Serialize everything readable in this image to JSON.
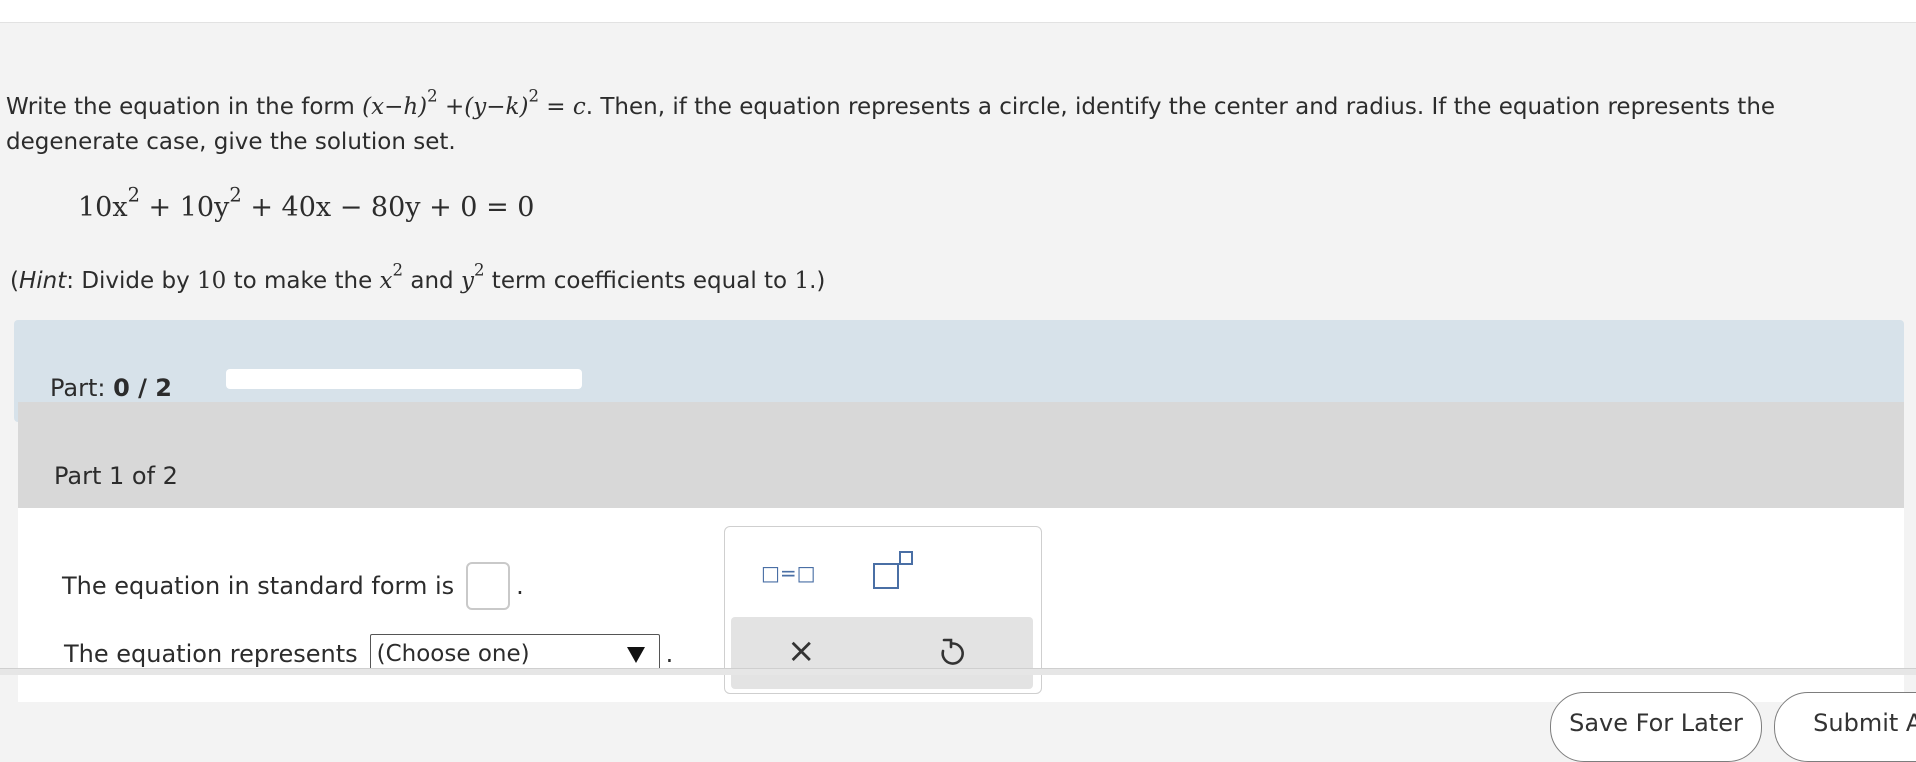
{
  "question": {
    "intro": "Write the equation in the form ",
    "form_math": "(x−h)",
    "form_plus": " +",
    "form_math2": "(y−k)",
    "form_eq": " = c",
    "rest": ". Then, if the equation represents a circle, identify the center and radius. If the equation represents the degenerate case, give the solution set."
  },
  "equation": {
    "t1": "10x",
    "t2": " + 10y",
    "t3": " + 40x − 80y + 0 = 0",
    "exp": "2"
  },
  "hint": {
    "open": "(",
    "label": "Hint",
    "text1": ": Divide by ",
    "num": "10",
    "text2": " to make the ",
    "x": "x",
    "and": " and ",
    "y": "y",
    "text3": " term coefficients equal to ",
    "one": "1",
    "close": ".)",
    "exp": "2"
  },
  "part_bar": {
    "label": "Part: ",
    "progress": "0 / 2",
    "progress_fraction": 0
  },
  "panel": {
    "title": "Part 1 of 2",
    "standard_form_label": "The equation in standard form is",
    "period": ".",
    "represents_label": "The equation represents",
    "select_value": "(Choose one)"
  },
  "toolbox": {
    "equals_template": "□=□",
    "clear_symbol": "×"
  },
  "footer": {
    "save_label": "Save For Later",
    "submit_label": "Submit As"
  },
  "colors": {
    "part_bar_bg": "#d7e2ea",
    "panel_head_bg": "#d8d8d8",
    "tool_accent": "#4a6fa5"
  }
}
